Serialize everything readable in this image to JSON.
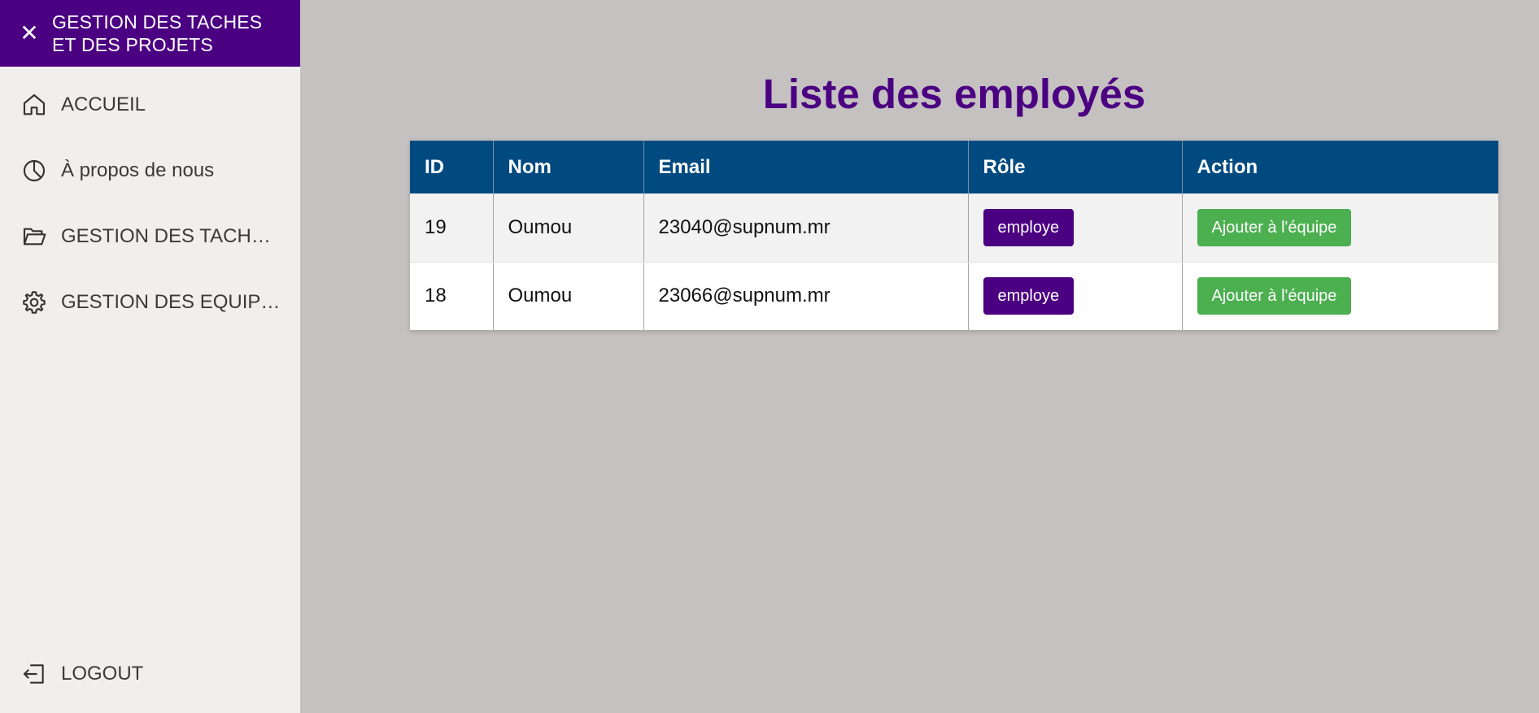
{
  "sidebar": {
    "brand_title": "GESTION DES TACHES ET DES PROJETS",
    "close_glyph": "✕",
    "items": [
      {
        "label": "ACCUEIL",
        "icon": "home-icon"
      },
      {
        "label": "À propos de nous",
        "icon": "pie-chart-icon"
      },
      {
        "label": "GESTION DES TACHES ET DES PROJETS",
        "icon": "folder-open-icon"
      },
      {
        "label": "GESTION DES EQUIPES",
        "icon": "gear-icon"
      }
    ],
    "logout": {
      "label": "LOGOUT",
      "icon": "logout-icon"
    }
  },
  "main": {
    "title": "Liste des employés",
    "table": {
      "headers": [
        "ID",
        "Nom",
        "Email",
        "Rôle",
        "Action"
      ],
      "rows": [
        {
          "id": "19",
          "nom": "Oumou",
          "email": "23040@supnum.mr",
          "role": "employe",
          "action": "Ajouter à l'équipe"
        },
        {
          "id": "18",
          "nom": "Oumou",
          "email": "23066@supnum.mr",
          "role": "employe",
          "action": "Ajouter à l'équipe"
        }
      ]
    }
  },
  "colors": {
    "brand": "#4b0082",
    "table_header": "#004a80",
    "action_button": "#4caf50",
    "background": "#c5c1c1",
    "sidebar_bg": "#f1efee"
  }
}
